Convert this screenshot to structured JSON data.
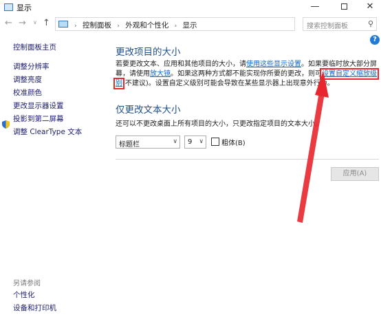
{
  "window": {
    "title": "显示",
    "min_glyph": "—",
    "close_glyph": "✕"
  },
  "nav": {
    "back_glyph": "←",
    "forward_glyph": "→",
    "dropdown_glyph": "∨",
    "up_glyph": "↑",
    "breadcrumbs": [
      "控制面板",
      "外观和个性化",
      "显示"
    ],
    "crumb_separator": "›",
    "refresh_glyph": "↻",
    "search_placeholder": "搜索控制面板",
    "search_glyph": "⚲"
  },
  "sidebar": {
    "home": "控制面板主页",
    "items": [
      "调整分辨率",
      "调整亮度",
      "校准颜色",
      "更改显示器设置",
      "投影到第二屏幕",
      "调整 ClearType 文本"
    ],
    "see_also": "另请参阅",
    "see_also_items": [
      "个性化",
      "设备和打印机"
    ]
  },
  "help_glyph": "?",
  "main": {
    "section1_title": "更改项目的大小",
    "p1_a": "若要更改文本、应用和其他项目的大小，请",
    "link_display_settings": "使用这些显示设置",
    "p1_b": "。如果要临时放大部分屏幕，请使用",
    "link_magnifier": "放大镜",
    "p1_c": "。如果这两种方式都不能实现你所要的更改，则可",
    "link_custom_zoom": "设置自定义缩放级别",
    "p1_d": "(不建议)。设置自定义级别可能会导致在某些显示器上出现意外行为。",
    "section2_title": "仅更改文本大小",
    "p2": "还可以不更改桌面上所有项目的大小，只更改指定项目的文本大小。",
    "item_select_value": "标题栏",
    "size_select_value": "9",
    "select_arrow": "∨",
    "bold_label": "粗体(B)",
    "apply_label": "应用(A)"
  },
  "colors": {
    "annotation": "#e8262e",
    "link": "#1466c4",
    "heading": "#1d4e8f"
  }
}
